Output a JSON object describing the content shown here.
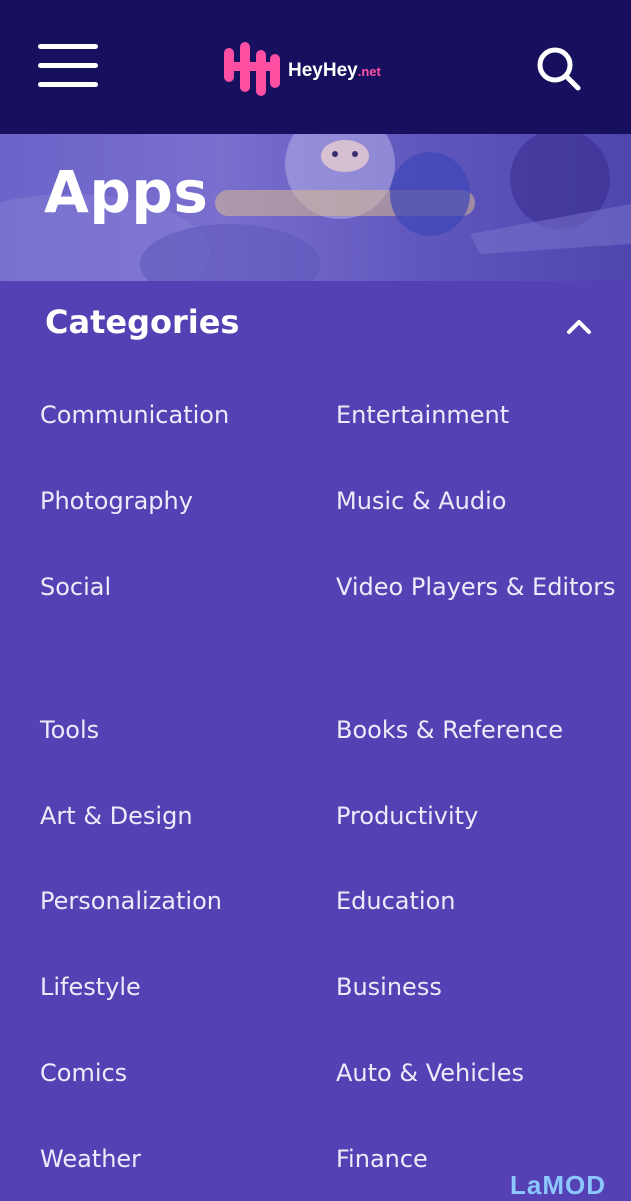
{
  "header": {
    "menu_icon": "hamburger-menu-icon",
    "logo": {
      "name": "HeyHey",
      "suffix": ".net"
    },
    "search_icon": "search-icon"
  },
  "hero": {
    "title": "Apps"
  },
  "categories": {
    "title": "Categories",
    "toggle_icon": "chevron-up-icon",
    "left": [
      "Communication",
      "Photography",
      "Social",
      "Tools",
      "Art & Design",
      "Personalization",
      "Lifestyle",
      "Comics",
      "Weather"
    ],
    "right": [
      "Entertainment",
      "Music & Audio",
      "Video Players & Editors",
      "Books & Reference",
      "Productivity",
      "Education",
      "Business",
      "Auto & Vehicles",
      "Finance"
    ]
  },
  "watermark": "LaMOD",
  "colors": {
    "header_bg": "#17105e",
    "page_bg": "#5541b3",
    "logo_pink": "#ff4fa3"
  }
}
